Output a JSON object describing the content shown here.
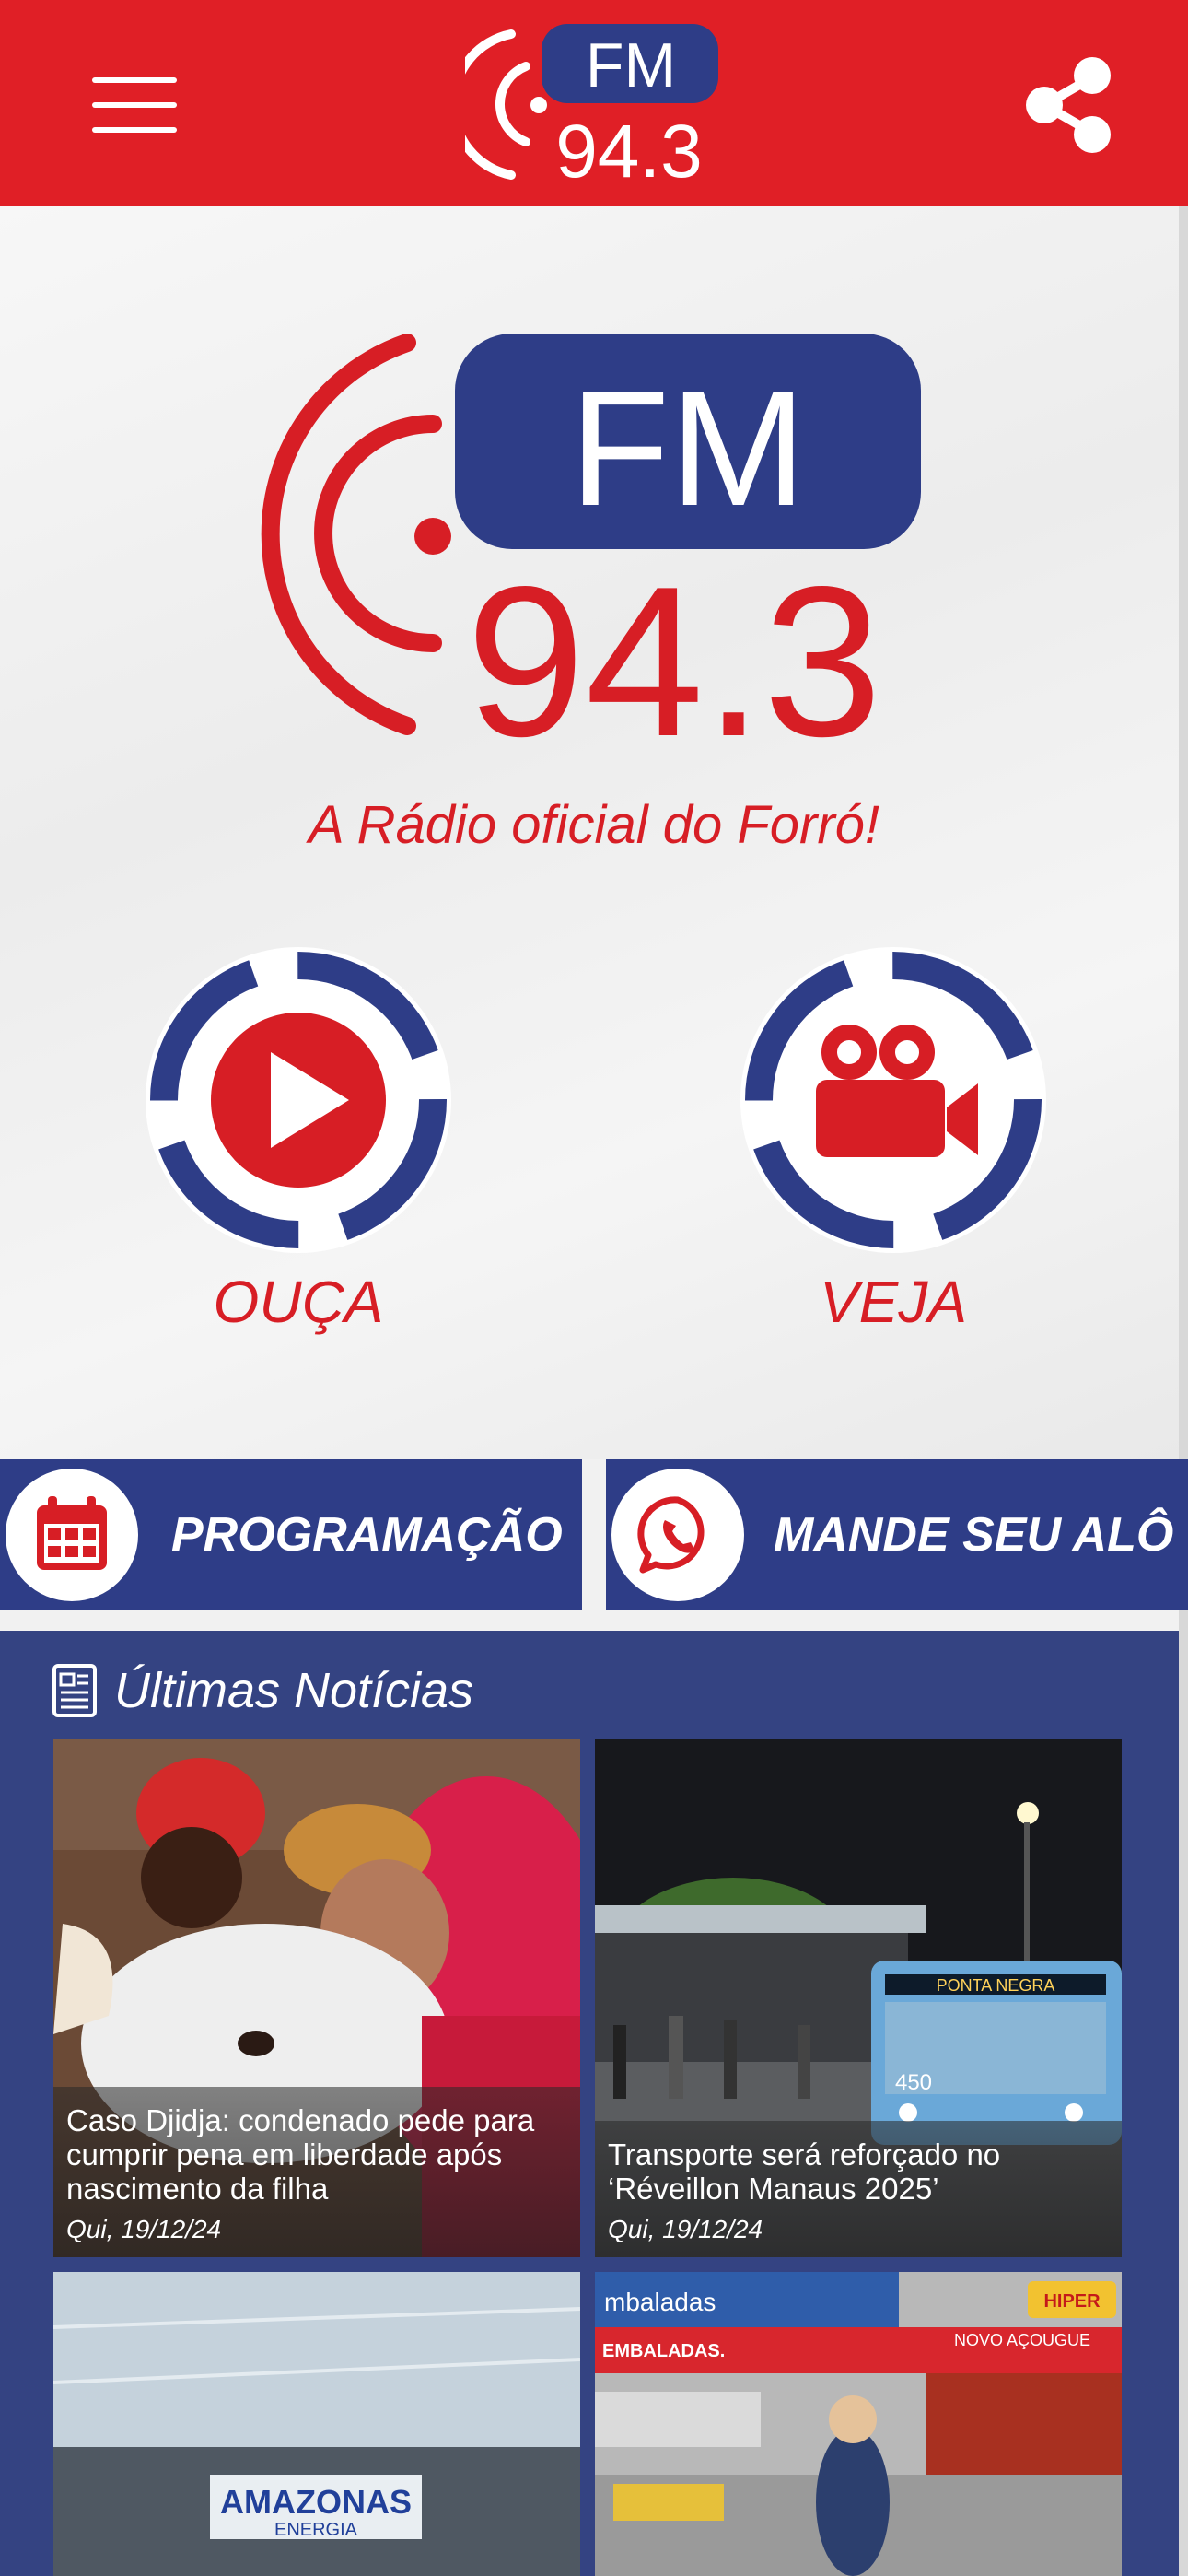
{
  "header": {
    "menu_icon": "hamburger-menu-icon",
    "logo": {
      "badge": "FM",
      "frequency": "94.3"
    },
    "share_icon": "share-icon"
  },
  "hero": {
    "logo": {
      "badge": "FM",
      "frequency": "94.3"
    },
    "tagline": "A Rádio oficial do Forró!",
    "listen": {
      "label": "OUÇA",
      "icon": "play-icon"
    },
    "watch": {
      "label": "VEJA",
      "icon": "video-camera-icon"
    }
  },
  "actions": {
    "schedule": {
      "label": "PROGRAMAÇÃO",
      "icon": "calendar-icon"
    },
    "whatsapp": {
      "label": "MANDE SEU ALÔ",
      "icon": "whatsapp-icon"
    }
  },
  "news": {
    "heading": "Últimas Notícias",
    "heading_icon": "newspaper-icon",
    "items": [
      {
        "title": "Caso Djidja: condenado pede para cumprir pena em liberdade após nascimento da filha",
        "date": "Qui, 19/12/24"
      },
      {
        "title": "Transporte será reforçado no ‘Réveillon Manaus 2025’",
        "date": "Qui, 19/12/24",
        "bus_sign": "450",
        "bus_route": "PONTA NEGRA"
      },
      {
        "title": "",
        "date": "",
        "sign_main": "AMAZONAS",
        "sign_sub": "ENERGIA"
      },
      {
        "title": "",
        "date": "",
        "store_sign_1": "mbaladas",
        "store_sign_2": "EMBALADAS.",
        "store_sign_3": "NOVO AÇOUGUE",
        "store_sign_4": "HIPER"
      }
    ]
  },
  "colors": {
    "brand_red": "#e01f26",
    "brand_blue": "#2e3d87",
    "news_bg": "#344382"
  }
}
